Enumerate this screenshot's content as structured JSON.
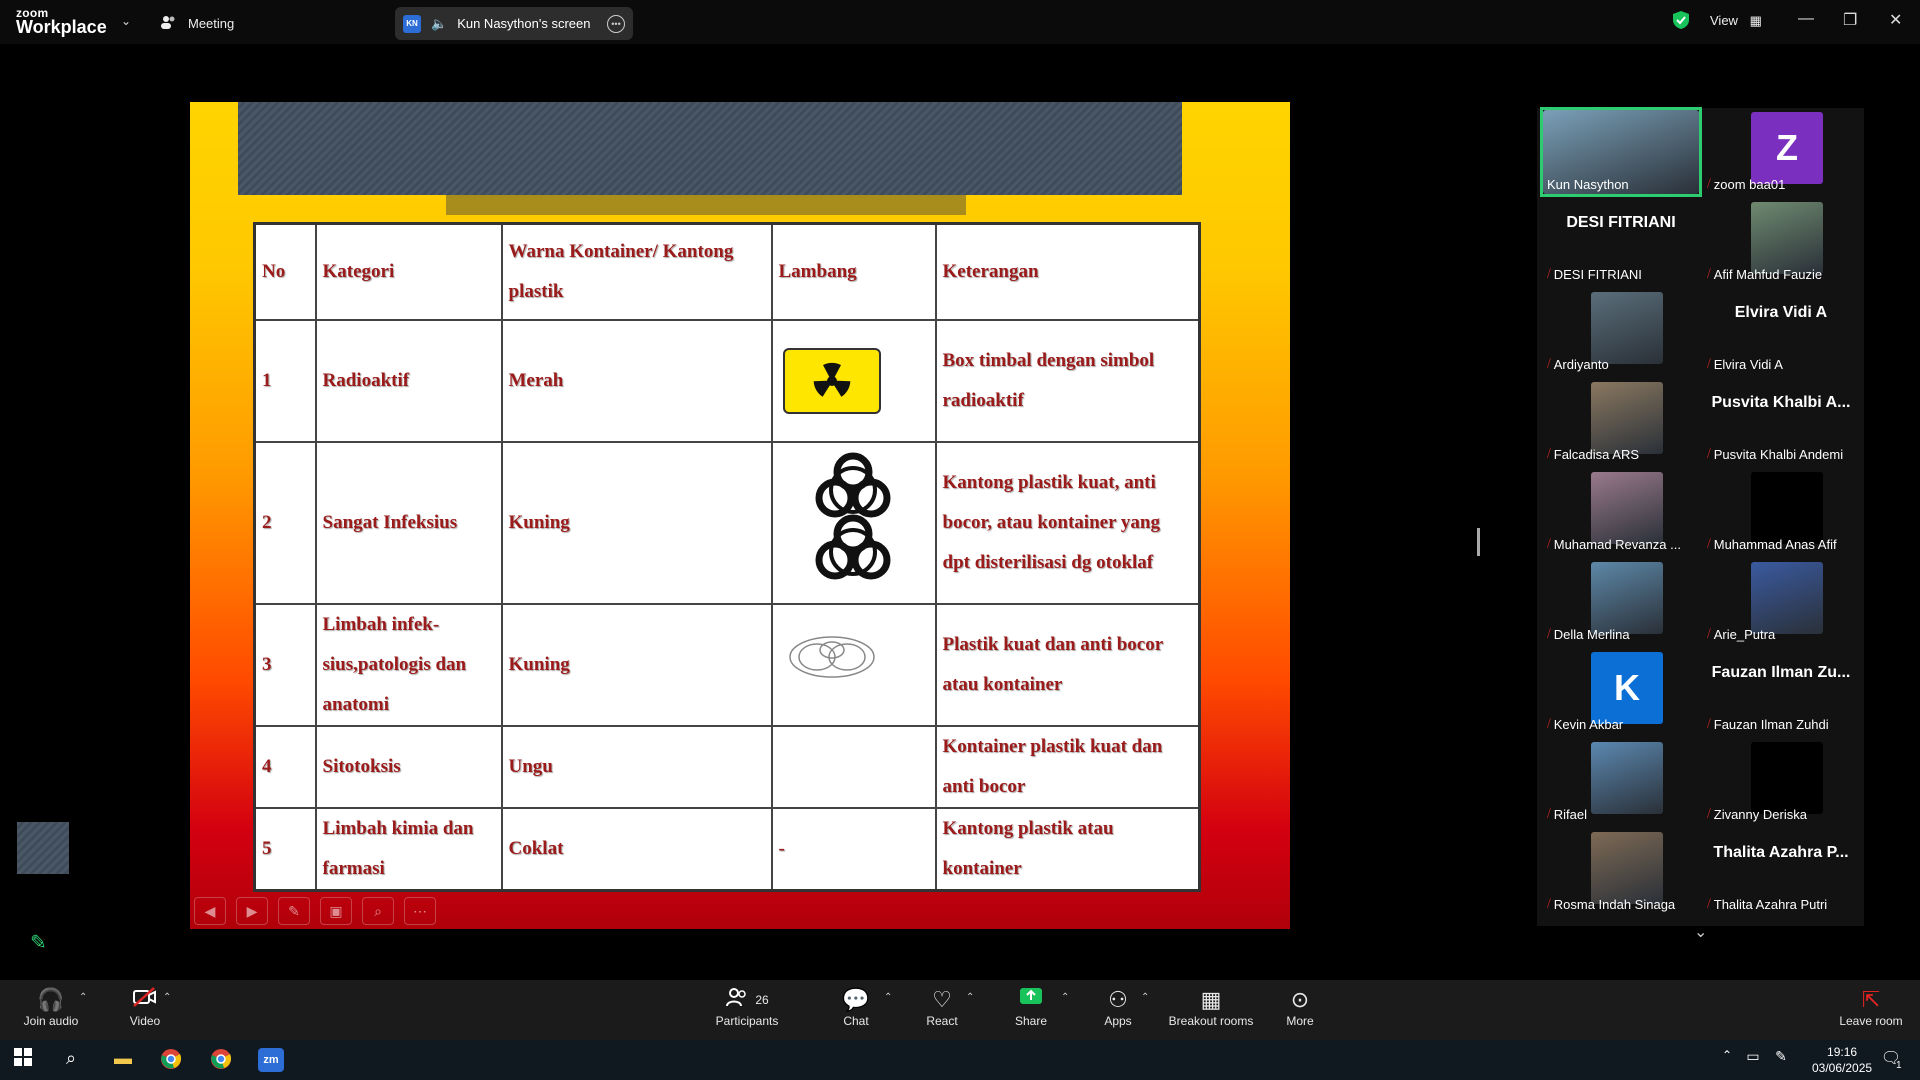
{
  "titlebar": {
    "logo_top": "zoom",
    "logo_bottom": "Workplace",
    "meeting_label": "Meeting",
    "screen_initials": "KN",
    "screen_label": "Kun Nasython's screen",
    "view_label": "View"
  },
  "slide": {
    "headers": [
      "No",
      "Kategori",
      "Warna Kontainer/ Kantong plastik",
      "Lambang",
      "Keterangan"
    ],
    "rows": [
      {
        "no": "1",
        "kategori": "Radioaktif",
        "warna": "Merah",
        "lambang": "radioactive-symbol",
        "keterangan": "Box timbal dengan simbol radioaktif"
      },
      {
        "no": "2",
        "kategori": "Sangat Infeksius",
        "warna": "Kuning",
        "lambang": "biohazard-symbol",
        "keterangan": "Kantong plastik kuat, anti bocor, atau kontainer yang dpt disterilisasi dg otoklaf"
      },
      {
        "no": "3",
        "kategori": "Limbah infek- sius,patologis dan anatomi",
        "warna": "Kuning",
        "lambang": "pathology-symbol",
        "keterangan": "Plastik kuat dan anti bocor atau kontainer"
      },
      {
        "no": "4",
        "kategori": "Sitotoksis",
        "warna": "Ungu",
        "lambang": "",
        "keterangan": "Kontainer plastik kuat dan anti bocor"
      },
      {
        "no": "5",
        "kategori": "Limbah kimia dan farmasi",
        "warna": "Coklat",
        "lambang": "-",
        "keterangan": "Kantong plastik atau kontainer"
      }
    ]
  },
  "gallery": {
    "participants": [
      {
        "name": "Kun Nasython",
        "big": "",
        "type": "video",
        "color": "#7aa0b8",
        "active": true
      },
      {
        "name": "zoom baa01",
        "big": "Z",
        "type": "initial",
        "color": "#7b2fbe"
      },
      {
        "name": "DESI FITRIANI",
        "big": "DESI FITRIANI",
        "type": "text"
      },
      {
        "name": "Afif Mahfud Fauzie",
        "big": "",
        "type": "video",
        "color": "#6f8a70"
      },
      {
        "name": "Ardiyanto",
        "big": "",
        "type": "video",
        "color": "#5a6e7a"
      },
      {
        "name": "Elvira Vidi A",
        "big": "Elvira Vidi A",
        "type": "text"
      },
      {
        "name": "Falcadisa ARS",
        "big": "",
        "type": "video",
        "color": "#8a7860"
      },
      {
        "name": "Pusvita Khalbi Andemi",
        "big": "Pusvita Khalbi A...",
        "type": "text"
      },
      {
        "name": "Muhamad Revanza ...",
        "big": "",
        "type": "video",
        "color": "#9a7a8c"
      },
      {
        "name": "Muhammad Anas Afif",
        "big": "",
        "type": "blank"
      },
      {
        "name": "Della Merlina",
        "big": "",
        "type": "video",
        "color": "#5d88a8"
      },
      {
        "name": "Arie_Putra",
        "big": "",
        "type": "video",
        "color": "#3a5aa0"
      },
      {
        "name": "Kevin Akbar",
        "big": "K",
        "type": "initial",
        "color": "#0b6fd6"
      },
      {
        "name": "Fauzan Ilman Zuhdi",
        "big": "Fauzan Ilman Zu...",
        "type": "text"
      },
      {
        "name": "Rifael",
        "big": "",
        "type": "video",
        "color": "#5b88b0"
      },
      {
        "name": "Zivanny Deriska",
        "big": "",
        "type": "blank"
      },
      {
        "name": "Rosma Indah Sinaga",
        "big": "",
        "type": "video",
        "color": "#7e6a55"
      },
      {
        "name": "Thalita Azahra Putri",
        "big": "Thalita Azahra P...",
        "type": "text"
      }
    ]
  },
  "toolbar": {
    "join_audio": "Join audio",
    "video": "Video",
    "participants": "Participants",
    "participants_count": "26",
    "chat": "Chat",
    "react": "React",
    "share": "Share",
    "apps": "Apps",
    "breakout": "Breakout rooms",
    "more": "More",
    "leave": "Leave room"
  },
  "taskbar": {
    "time": "19:16",
    "date": "03/06/2025",
    "notif_count": "1"
  },
  "colors": {
    "active_border": "#2ecc71",
    "share_green": "#19c35b",
    "leave_red": "#e02424"
  }
}
